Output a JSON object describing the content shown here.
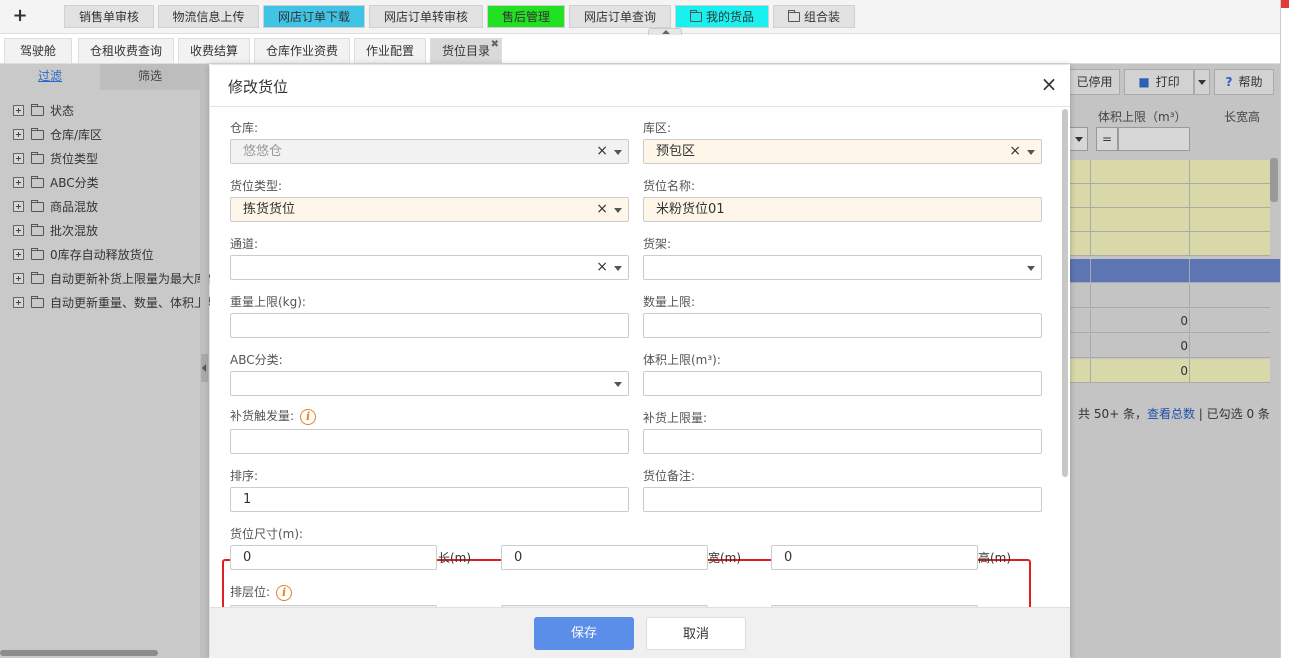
{
  "top_tabs": {
    "plus": "+",
    "items": [
      {
        "label": "销售单审核"
      },
      {
        "label": "物流信息上传"
      },
      {
        "label": "网店订单下载",
        "color": "#40c4e6"
      },
      {
        "label": "网店订单转审核"
      },
      {
        "label": "售后管理",
        "color": "#22e022"
      },
      {
        "label": "网店订单查询"
      },
      {
        "label": "我的货品",
        "color": "#19f0f0",
        "icon": "folder-icon"
      },
      {
        "label": "组合装",
        "icon": "folder-icon"
      }
    ]
  },
  "sub_tabs": [
    {
      "label": "驾驶舱"
    },
    {
      "label": "仓租收费查询"
    },
    {
      "label": "收费结算"
    },
    {
      "label": "仓库作业资费"
    },
    {
      "label": "作业配置"
    },
    {
      "label": "货位目录",
      "active": true,
      "close": "✖"
    }
  ],
  "left_panel": {
    "tabs": [
      "过滤",
      "筛选"
    ],
    "tree": [
      "状态",
      "仓库/库区",
      "货位类型",
      "ABC分类",
      "商品混放",
      "批次混放",
      "0库存自动释放货位",
      "自动更新补货上限量为最大库存",
      "自动更新重量、数量、体积上限"
    ]
  },
  "background": {
    "toolbar": {
      "disabled": "已停用",
      "print": "打印",
      "help": "帮助",
      "print_icon": "cube-icon",
      "help_icon": "question-icon"
    },
    "headers": {
      "volume": "体积上限（m³）",
      "lwh": "长宽高"
    },
    "filter_eq": "=",
    "row_values": [
      "0",
      "0",
      "0"
    ],
    "footer": {
      "total": "共 50+ 条，",
      "view_total": "查看总数",
      "selected": " | 已勾选 0 条"
    },
    "colors": {
      "yellow_row": "#d8d8a8",
      "selected_row": "#5d76b3"
    }
  },
  "modal": {
    "title": "修改货位",
    "close": "×",
    "fields": {
      "warehouse": {
        "label": "仓库:",
        "value": "悠悠仓",
        "clear": "×"
      },
      "zone": {
        "label": "库区:",
        "value": "预包区",
        "clear": "×"
      },
      "slot_type": {
        "label": "货位类型:",
        "value": "拣货货位",
        "clear": "×"
      },
      "slot_name": {
        "label": "货位名称:",
        "value": "米粉货位01"
      },
      "aisle": {
        "label": "通道:",
        "value": "",
        "clear": "×"
      },
      "shelf": {
        "label": "货架:",
        "value": ""
      },
      "weight_limit": {
        "label": "重量上限(kg):",
        "value": ""
      },
      "qty_limit": {
        "label": "数量上限:",
        "value": ""
      },
      "abc": {
        "label": "ABC分类:",
        "value": ""
      },
      "volume_limit": {
        "label": "体积上限(m³):",
        "value": ""
      },
      "replenish_trigger": {
        "label": "补货触发量:",
        "value": "",
        "info": "i"
      },
      "replenish_limit": {
        "label": "补货上限量:",
        "value": ""
      },
      "sort": {
        "label": "排序:",
        "value": "1"
      },
      "remark": {
        "label": "货位备注:",
        "value": ""
      },
      "size": {
        "label": "货位尺寸(m):",
        "length": "0",
        "width": "0",
        "height": "0",
        "length_unit": "长(m)",
        "width_unit": "宽(m)",
        "height_unit": "高(m)"
      },
      "layer": {
        "label": "排层位:",
        "info": "i"
      }
    },
    "buttons": {
      "save": "保存",
      "cancel": "取消"
    },
    "colors": {
      "required_bg": "#fdf6e9",
      "save_bg": "#5b8ee8",
      "highlight_border": "#e02020"
    }
  }
}
